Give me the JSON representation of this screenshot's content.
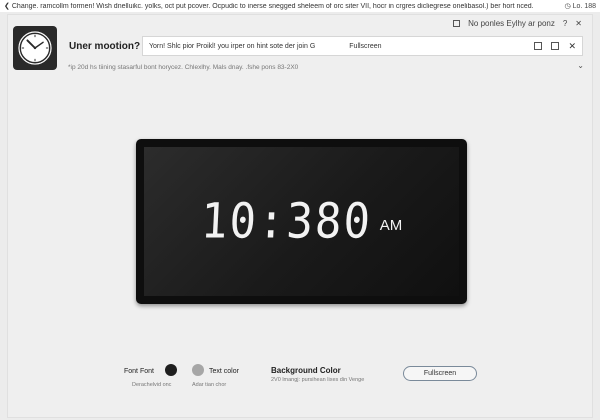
{
  "topbar": {
    "message": "Change. ramcollm formen! Wish dnelluikc. yolks, oct put pcover. Ocpudic to inerse snegged sheleem of orc siter VII, hocr in crgres dicliegrese onelibasol.) ber hort nced.",
    "status": "Lo. 188"
  },
  "app": {
    "title": "Uner mootion?",
    "logo_icon": "clock-icon",
    "window_controls": {
      "label": "No ponles Eylhy ar ponz",
      "help_symbol": "?",
      "close_symbol": "✕"
    },
    "address_bar": {
      "text": "Yorn! Shlc pior Proikl! you irper on hint sote der join G",
      "fullscreen_label": "Fullscreen",
      "close_symbol": "✕"
    },
    "subtitle": "*ip 20d hs tiining stasarful bont horycez. Chlexlhy. Mals dnay. .fshe pons   83-2X0",
    "chevron_symbol": "⌄"
  },
  "clock": {
    "time": "10:380",
    "ampm": "AM"
  },
  "controls": {
    "font_color": {
      "label": "Font Font",
      "sub": "Derachelvid onc",
      "color": "#1e1e1e"
    },
    "text_color": {
      "label": "Text color",
      "sub": "Adar tian chor",
      "color": "#a6a6a6"
    },
    "background": {
      "label": "Background Color",
      "sub": "2V0 lmangj: pursihean lixes din Venge"
    },
    "fullscreen_button": "Fullscreen"
  }
}
